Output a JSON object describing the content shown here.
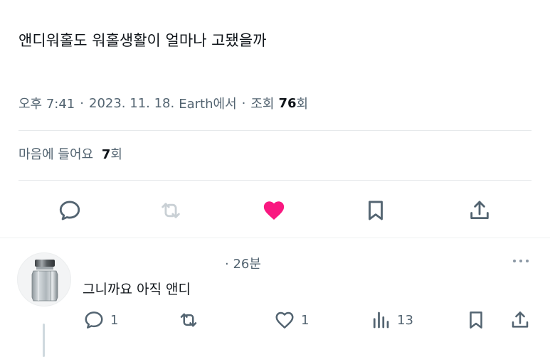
{
  "post": {
    "text": "앤디워홀도 워홀생활이 얼마나 고됐을까"
  },
  "meta": {
    "time": "오후 7:41",
    "separator1": "·",
    "date": "2023. 11. 18.",
    "source": "Earth에서",
    "separator2": "·",
    "views_label": "조회",
    "views_count": "76",
    "views_suffix": "회"
  },
  "likes": {
    "label": "마음에 들어요",
    "count": "7",
    "suffix": "회"
  },
  "actions": {
    "icons": [
      "comment-icon",
      "retweet-icon",
      "heart-filled-icon",
      "bookmark-icon",
      "share-icon"
    ],
    "heart_color": "#f91880",
    "retweet_color": "#c9d0d5",
    "icon_color": "#536471"
  },
  "reply": {
    "time": "· 26분",
    "text": "그니까요 아직 앤디",
    "reply_count": "1",
    "retweet_count": "",
    "like_count": "1",
    "views_count": "13"
  }
}
